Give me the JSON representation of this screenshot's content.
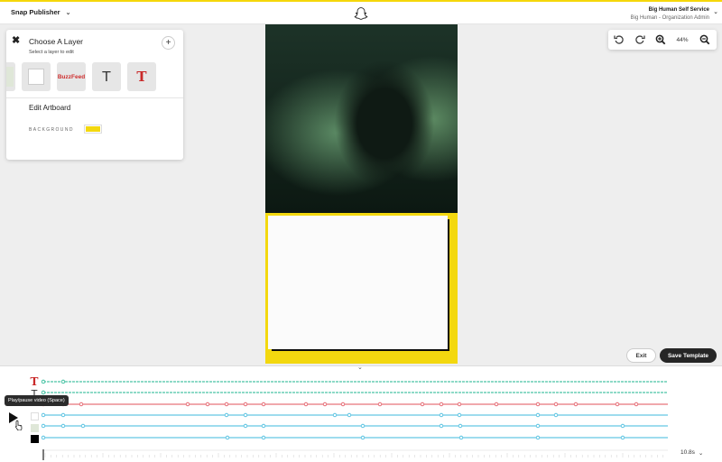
{
  "header": {
    "app_name": "Snap Publisher",
    "logo_icon": "snapchat-ghost-icon",
    "account_name": "Big Human Self Service",
    "account_role": "Big Human - Organization Admin"
  },
  "layer_panel": {
    "title": "Choose A Layer",
    "subtitle": "Select a layer to edit",
    "layers": [
      {
        "kind": "image",
        "name": "sage-image-layer"
      },
      {
        "kind": "shape",
        "name": "white-rectangle-layer"
      },
      {
        "kind": "logo",
        "text": "BuzzFeed"
      },
      {
        "kind": "text",
        "glyph": "T"
      },
      {
        "kind": "text-bold",
        "glyph": "T"
      }
    ],
    "artboard_title": "Edit Artboard",
    "background_label": "BACKGROUND",
    "background_color": "#f3d80f"
  },
  "zoom": {
    "level": "44%",
    "icons": [
      "undo-icon",
      "redo-icon",
      "zoom-in-icon",
      "zoom-out-icon"
    ]
  },
  "actions": {
    "exit_label": "Exit",
    "save_label": "Save Template"
  },
  "timeline": {
    "tooltip": "Play/pause video (Space)",
    "duration": "10.8s",
    "colors": {
      "teal": "#1db58f",
      "red": "#e0505a",
      "blue": "#3cb8dc"
    }
  }
}
